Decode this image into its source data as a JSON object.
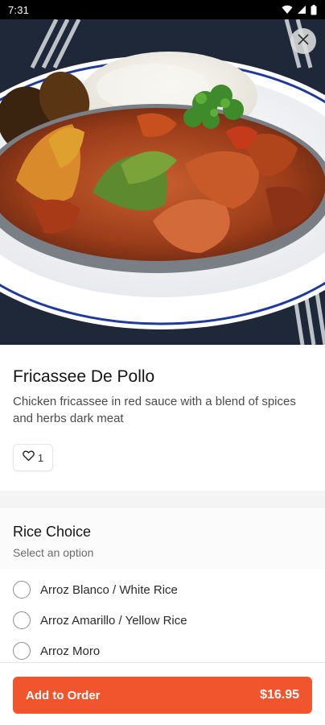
{
  "status_bar": {
    "time": "7:31",
    "icons": [
      "wifi-icon",
      "signal-icon",
      "battery-icon"
    ]
  },
  "hero": {
    "image_alt": "food-photo",
    "close_icon": "close-icon"
  },
  "item": {
    "title": "Fricassee De Pollo",
    "description": "Chicken fricassee in red sauce with a blend of spices and herbs dark meat",
    "likes": "1"
  },
  "modifier_group": {
    "title": "Rice Choice",
    "subtitle": "Select an option",
    "options": [
      {
        "label": "Arroz Blanco / White Rice"
      },
      {
        "label": "Arroz Amarillo / Yellow Rice"
      },
      {
        "label": "Arroz Moro"
      }
    ]
  },
  "footer": {
    "add_label": "Add to Order",
    "price": "$16.95"
  },
  "colors": {
    "accent": "#f1552e",
    "status_bar": "#000000"
  }
}
